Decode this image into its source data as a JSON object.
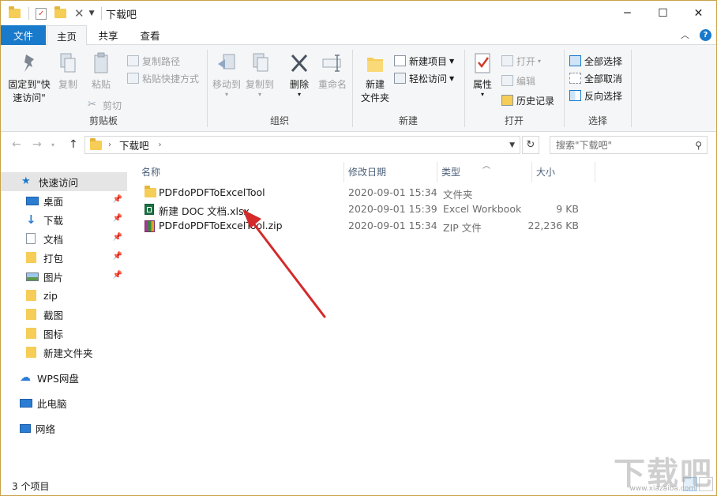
{
  "window": {
    "title": "下载吧",
    "minimize": "─",
    "maximize": "☐",
    "close": "✕"
  },
  "tabs": {
    "file": "文件",
    "home": "主页",
    "share": "共享",
    "view": "查看"
  },
  "ribbon": {
    "clipboard": {
      "label": "剪贴板",
      "pin_line1": "固定到\"快",
      "pin_line2": "速访问\"",
      "copy": "复制",
      "paste": "粘贴",
      "copy_path": "复制路径",
      "paste_shortcut": "粘贴快捷方式",
      "cut": "剪切"
    },
    "organize": {
      "label": "组织",
      "move_to": "移动到",
      "copy_to": "复制到",
      "delete": "删除",
      "rename": "重命名"
    },
    "new": {
      "label": "新建",
      "new_folder_line1": "新建",
      "new_folder_line2": "文件夹",
      "new_item": "新建项目",
      "easy_access": "轻松访问"
    },
    "open": {
      "label": "打开",
      "properties": "属性",
      "open": "打开",
      "edit": "编辑",
      "history": "历史记录"
    },
    "select": {
      "label": "选择",
      "select_all": "全部选择",
      "select_none": "全部取消",
      "invert": "反向选择"
    }
  },
  "address": {
    "path": "下载吧",
    "search_placeholder": "搜索\"下载吧\""
  },
  "navpane": {
    "quick_access": "快速访问",
    "items": [
      {
        "label": "桌面",
        "pinned": true
      },
      {
        "label": "下载",
        "pinned": true
      },
      {
        "label": "文档",
        "pinned": true
      },
      {
        "label": "打包",
        "pinned": true
      },
      {
        "label": "图片",
        "pinned": true
      },
      {
        "label": "zip",
        "pinned": false
      },
      {
        "label": "截图",
        "pinned": false
      },
      {
        "label": "图标",
        "pinned": false
      },
      {
        "label": "新建文件夹",
        "pinned": false
      }
    ],
    "wps": "WPS网盘",
    "this_pc": "此电脑",
    "network": "网络"
  },
  "columns": {
    "name": "名称",
    "modified": "修改日期",
    "type": "类型",
    "size": "大小"
  },
  "files": [
    {
      "name": "PDFdoPDFToExcelTool",
      "modified": "2020-09-01 15:34",
      "type": "文件夹",
      "size": "",
      "icon": "folder-icon"
    },
    {
      "name": "新建 DOC 文档.xlsx",
      "modified": "2020-09-01 15:39",
      "type": "Excel Workbook",
      "size": "9 KB",
      "icon": "excel-icon"
    },
    {
      "name": "PDFdoPDFToExcelTool.zip",
      "modified": "2020-09-01 15:34",
      "type": "ZIP 文件",
      "size": "22,236 KB",
      "icon": "zip-icon"
    }
  ],
  "status": {
    "count": "3 个项目"
  },
  "watermark": {
    "text": "下载吧",
    "url": "www.xiazaiba.com"
  },
  "colors": {
    "accent": "#1979ca",
    "arrow": "#d42a2a"
  }
}
